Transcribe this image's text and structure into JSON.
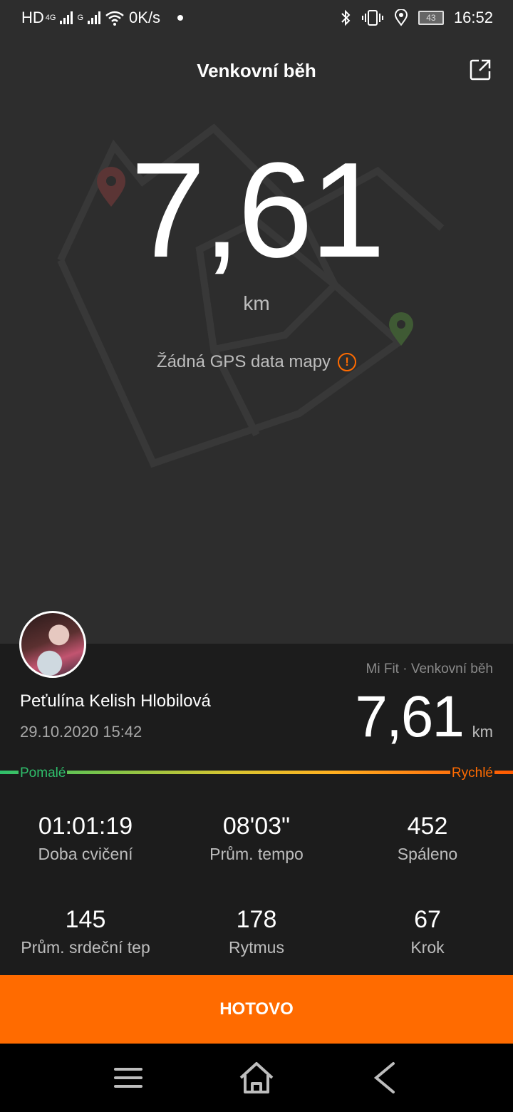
{
  "status_bar": {
    "network": "HD",
    "sim1_tag": "4G",
    "sim2_tag": "G",
    "speed": "0K/s",
    "battery": "43",
    "time": "16:52"
  },
  "header": {
    "title": "Venkovní běh",
    "share_icon": "share-icon"
  },
  "hero": {
    "distance": "7,61",
    "unit": "km",
    "gps_message": "Žádná GPS data mapy",
    "warning_icon": "!"
  },
  "summary": {
    "source": "Mi Fit · Venkovní běh",
    "user_name": "Peťulína Kelish Hlobilová",
    "datetime": "29.10.2020 15:42",
    "distance": "7,61",
    "unit": "km",
    "pace_slow": "Pomalé",
    "pace_fast": "Rychlé",
    "colors": {
      "slow": "#2fbf6b",
      "fast": "#ff6b00"
    }
  },
  "stats": [
    {
      "value": "01:01:19",
      "label": "Doba cvičení"
    },
    {
      "value": "08'03\"",
      "label": "Prům. tempo"
    },
    {
      "value": "452",
      "label": "Spáleno"
    },
    {
      "value": "145",
      "label": "Prům. srdeční tep"
    },
    {
      "value": "178",
      "label": "Rytmus"
    },
    {
      "value": "67",
      "label": "Krok"
    }
  ],
  "done_button": {
    "label": "HOTOVO",
    "color": "#ff6b00"
  },
  "nav": {
    "menu_icon": "menu-icon",
    "home_icon": "home-icon",
    "back_icon": "back-icon"
  }
}
